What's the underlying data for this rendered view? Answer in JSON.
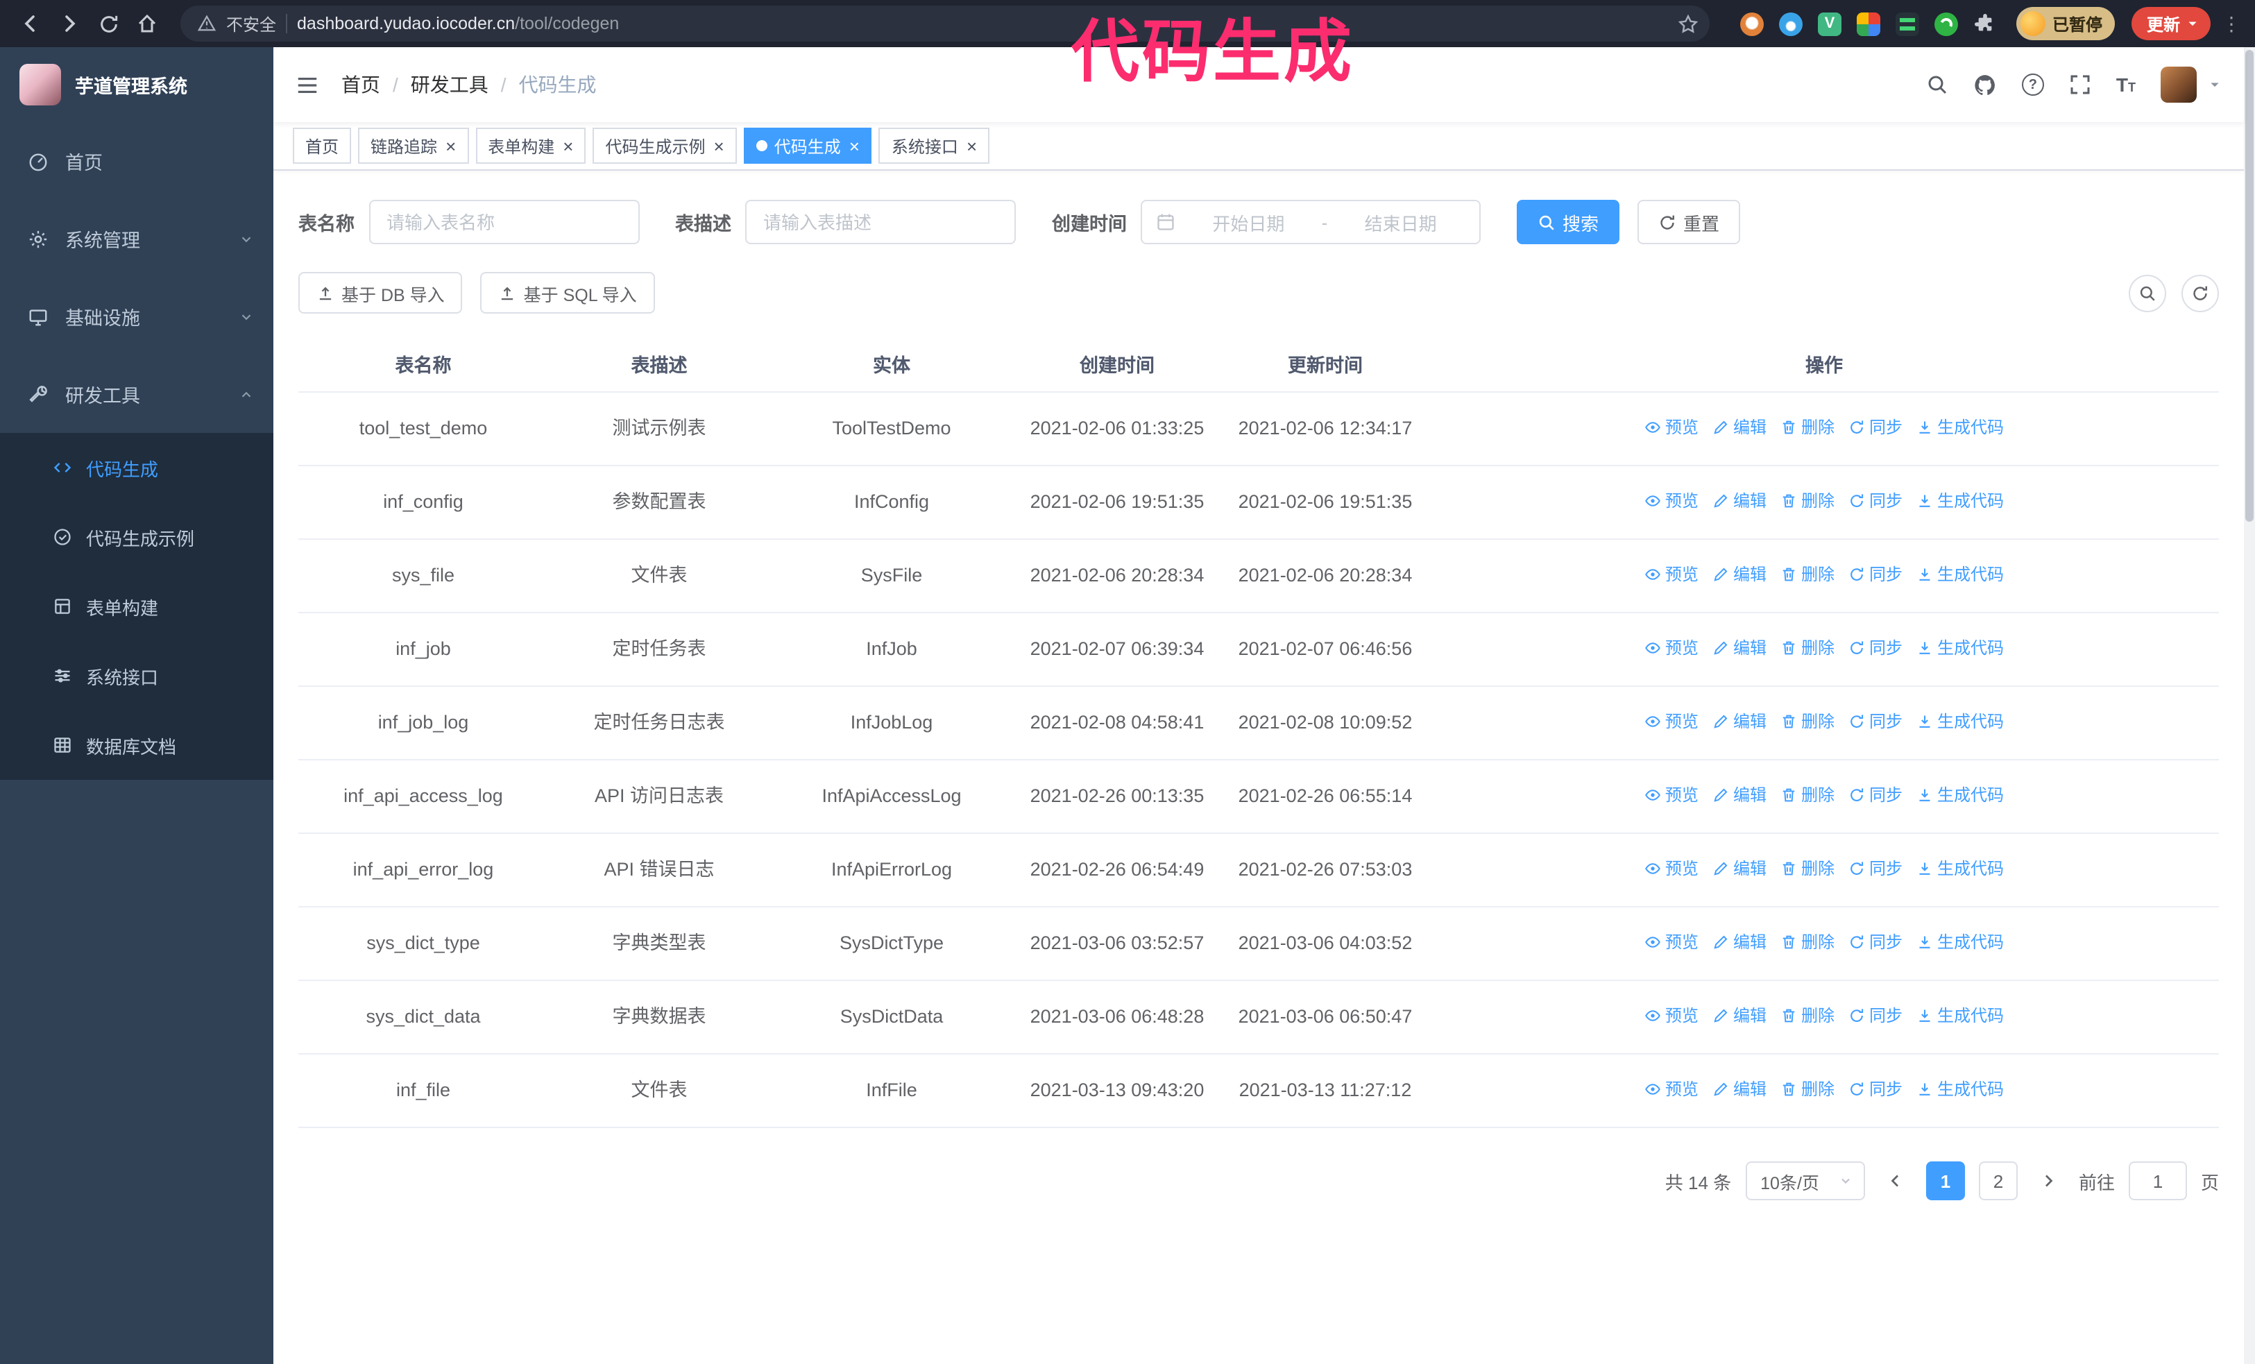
{
  "annotation": {
    "text": "代码生成",
    "color": "#fb2d6f"
  },
  "browser": {
    "security_label": "不安全",
    "url_host": "dashboard.yudao.iocoder.cn",
    "url_path": "/tool/codegen",
    "paused_badge": "已暂停",
    "update_button": "更新"
  },
  "app": {
    "title": "芋道管理系统"
  },
  "sidebar": {
    "items": [
      {
        "label": "首页",
        "icon": "dashboard-icon"
      },
      {
        "label": "系统管理",
        "icon": "gear-icon",
        "chevron": "down"
      },
      {
        "label": "基础设施",
        "icon": "monitor-icon",
        "chevron": "down"
      },
      {
        "label": "研发工具",
        "icon": "tools-icon",
        "chevron": "up",
        "expanded": true
      }
    ],
    "submenu": [
      {
        "label": "代码生成",
        "icon": "code-icon",
        "active": true
      },
      {
        "label": "代码生成示例",
        "icon": "example-icon",
        "active": false
      },
      {
        "label": "表单构建",
        "icon": "form-icon",
        "active": false
      },
      {
        "label": "系统接口",
        "icon": "api-icon",
        "active": false
      },
      {
        "label": "数据库文档",
        "icon": "database-icon",
        "active": false
      }
    ]
  },
  "header": {
    "breadcrumb": [
      "首页",
      "研发工具",
      "代码生成"
    ],
    "separator": "/"
  },
  "tabs": [
    {
      "label": "首页",
      "closable": false,
      "active": false
    },
    {
      "label": "链路追踪",
      "closable": true,
      "active": false
    },
    {
      "label": "表单构建",
      "closable": true,
      "active": false
    },
    {
      "label": "代码生成示例",
      "closable": true,
      "active": false
    },
    {
      "label": "代码生成",
      "closable": true,
      "active": true
    },
    {
      "label": "系统接口",
      "closable": true,
      "active": false
    }
  ],
  "filters": {
    "table_name": {
      "label": "表名称",
      "placeholder": "请输入表名称",
      "value": ""
    },
    "table_desc": {
      "label": "表描述",
      "placeholder": "请输入表描述",
      "value": ""
    },
    "create_time": {
      "label": "创建时间",
      "start_placeholder": "开始日期",
      "separator": "-",
      "end_placeholder": "结束日期"
    },
    "search_button": "搜索",
    "reset_button": "重置"
  },
  "toolbar": {
    "import_db_button": "基于 DB 导入",
    "import_sql_button": "基于 SQL 导入"
  },
  "table": {
    "columns": [
      "表名称",
      "表描述",
      "实体",
      "创建时间",
      "更新时间",
      "操作"
    ],
    "actions": [
      "预览",
      "编辑",
      "删除",
      "同步",
      "生成代码"
    ],
    "rows": [
      {
        "name": "tool_test_demo",
        "desc": "测试示例表",
        "entity": "ToolTestDemo",
        "created": "2021-02-06 01:33:25",
        "updated": "2021-02-06 12:34:17"
      },
      {
        "name": "inf_config",
        "desc": "参数配置表",
        "entity": "InfConfig",
        "created": "2021-02-06 19:51:35",
        "updated": "2021-02-06 19:51:35"
      },
      {
        "name": "sys_file",
        "desc": "文件表",
        "entity": "SysFile",
        "created": "2021-02-06 20:28:34",
        "updated": "2021-02-06 20:28:34"
      },
      {
        "name": "inf_job",
        "desc": "定时任务表",
        "entity": "InfJob",
        "created": "2021-02-07 06:39:34",
        "updated": "2021-02-07 06:46:56"
      },
      {
        "name": "inf_job_log",
        "desc": "定时任务日志表",
        "entity": "InfJobLog",
        "created": "2021-02-08 04:58:41",
        "updated": "2021-02-08 10:09:52"
      },
      {
        "name": "inf_api_access_log",
        "desc": "API 访问日志表",
        "entity": "InfApiAccessLog",
        "created": "2021-02-26 00:13:35",
        "updated": "2021-02-26 06:55:14"
      },
      {
        "name": "inf_api_error_log",
        "desc": "API 错误日志",
        "entity": "InfApiErrorLog",
        "created": "2021-02-26 06:54:49",
        "updated": "2021-02-26 07:53:03"
      },
      {
        "name": "sys_dict_type",
        "desc": "字典类型表",
        "entity": "SysDictType",
        "created": "2021-03-06 03:52:57",
        "updated": "2021-03-06 04:03:52"
      },
      {
        "name": "sys_dict_data",
        "desc": "字典数据表",
        "entity": "SysDictData",
        "created": "2021-03-06 06:48:28",
        "updated": "2021-03-06 06:50:47"
      },
      {
        "name": "inf_file",
        "desc": "文件表",
        "entity": "InfFile",
        "created": "2021-03-13 09:43:20",
        "updated": "2021-03-13 11:27:12"
      }
    ]
  },
  "pagination": {
    "total": "共 14 条",
    "page_size": "10条/页",
    "pages": [
      "1",
      "2"
    ],
    "active_page": "1",
    "goto_label": "前往",
    "goto_value": "1",
    "goto_unit": "页"
  },
  "colors": {
    "accent": "#409eff",
    "sidebar_bg": "#304156",
    "submenu_bg": "#1f2d3d",
    "annotation": "#fb2d6f",
    "update_button_bg": "#e2483d",
    "paused_badge_bg": "#d8bd87"
  }
}
